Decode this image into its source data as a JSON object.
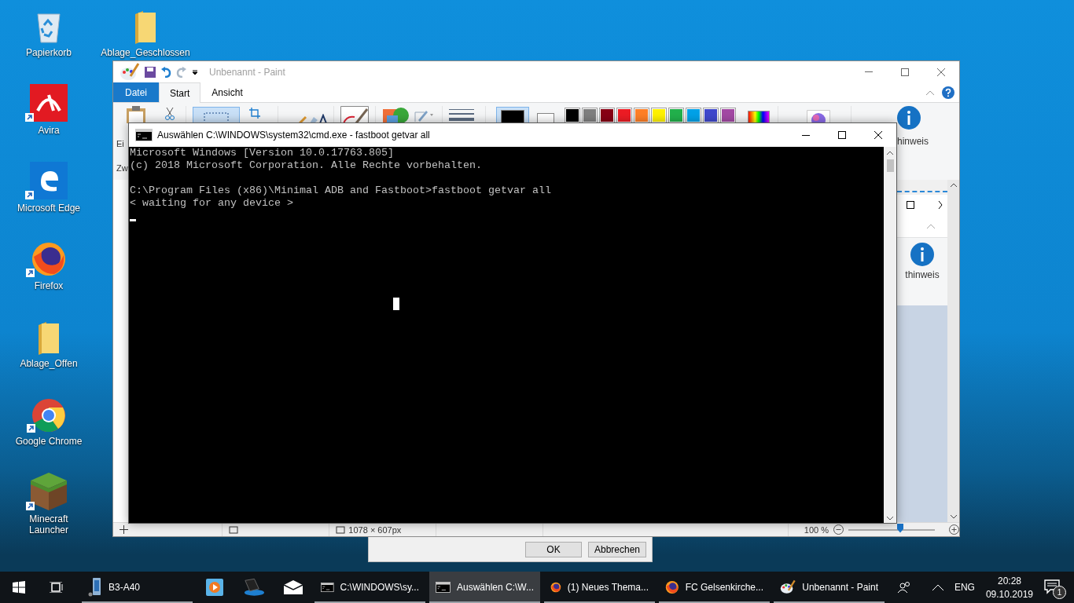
{
  "desktop": {
    "icons_left": [
      {
        "label": "Papierkorb",
        "kind": "recycle",
        "shortcut": false
      },
      {
        "label": "Avira",
        "kind": "avira",
        "shortcut": true
      },
      {
        "label": "Microsoft Edge",
        "kind": "edge",
        "shortcut": true
      },
      {
        "label": "Firefox",
        "kind": "firefox",
        "shortcut": true
      },
      {
        "label": "Ablage_Offen",
        "kind": "folder",
        "shortcut": false
      },
      {
        "label": "Google Chrome",
        "kind": "chrome",
        "shortcut": true
      },
      {
        "label": "Minecraft Launcher",
        "kind": "minecraft",
        "shortcut": true
      }
    ],
    "icons_right": [
      {
        "label": "Ablage_Geschlossen",
        "kind": "folder",
        "shortcut": false
      }
    ]
  },
  "paint": {
    "title": "Unbenannt - Paint",
    "tabs": [
      {
        "label": "Datei",
        "kind": "file",
        "selected": false
      },
      {
        "label": "Start",
        "kind": "tab",
        "selected": true
      },
      {
        "label": "Ansicht",
        "kind": "tab",
        "selected": false
      }
    ],
    "palette": [
      {
        "color": "#000000"
      },
      {
        "color": "#7f7f7f"
      },
      {
        "color": "#880015"
      },
      {
        "color": "#ed1c24"
      },
      {
        "color": "#ff7f27"
      },
      {
        "color": "#fff200"
      },
      {
        "color": "#22b14c"
      },
      {
        "color": "#00a2e8"
      },
      {
        "color": "#3f48cc"
      },
      {
        "color": "#a349a4"
      }
    ],
    "color_1": {
      "color": "#000000",
      "selected": true
    },
    "color_2": {
      "color": "#ffffff",
      "selected": false
    },
    "ribbon_cut_text": "hinweis",
    "left_cut_texts": [
      "Ei",
      "Zw"
    ],
    "inner_cut_text": "thinweis",
    "status_size": "1078 × 607px",
    "zoom": "100 %",
    "zoom_slider": {
      "level": 0.6
    }
  },
  "dialog": {
    "buttons": [
      "OK",
      "Abbrechen"
    ]
  },
  "cmd": {
    "title": "Auswählen C:\\WINDOWS\\system32\\cmd.exe - fastboot  getvar all",
    "paragraphs": [
      [
        "Microsoft Windows [Version 10.0.17763.805]",
        "(c) 2018 Microsoft Corporation. Alle Rechte vorbehalten."
      ],
      [
        "C:\\Program Files (x86)\\Minimal ADB and Fastboot>fastboot getvar all",
        "< waiting for any device >"
      ]
    ]
  },
  "taskbar": {
    "items": [
      {
        "kind": "phone",
        "label": "B3-A40",
        "running": true,
        "selected": false
      },
      {
        "kind": "media",
        "running": false,
        "selected": false
      },
      {
        "kind": "laptop",
        "running": false,
        "selected": false
      },
      {
        "kind": "mail",
        "running": false,
        "selected": false
      },
      {
        "kind": "console",
        "label": "C:\\WINDOWS\\sy...",
        "running": true,
        "selected": false
      },
      {
        "kind": "console",
        "label": "Auswählen C:\\W...",
        "running": true,
        "selected": true
      },
      {
        "kind": "firefox",
        "label": "(1) Neues Thema...",
        "running": true,
        "selected": false
      },
      {
        "kind": "firefox",
        "label": "FC Gelsenkirche...",
        "running": true,
        "selected": false
      },
      {
        "kind": "paint",
        "label": "Unbenannt - Paint",
        "running": true,
        "selected": false
      }
    ],
    "language": "ENG",
    "time": "20:28",
    "date": "09.10.2019",
    "notification_count": "1"
  }
}
